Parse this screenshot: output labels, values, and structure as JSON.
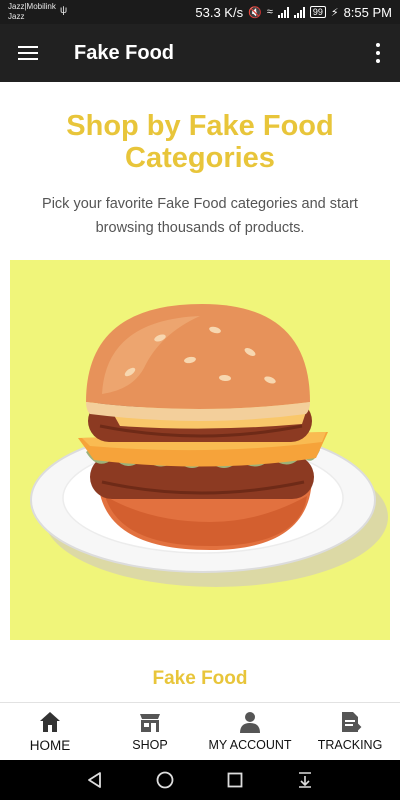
{
  "status_bar": {
    "carrier_line1": "Jazz|Mobilink",
    "carrier_line2": "Jazz",
    "speed": "53.3 K/s",
    "battery": "99",
    "time": "8:55 PM"
  },
  "app_bar": {
    "title": "Fake Food",
    "menu_icon": "hamburger-menu-icon",
    "more_icon": "more-vertical-icon"
  },
  "main": {
    "headline": "Shop by Fake Food Categories",
    "subtext": "Pick your favorite Fake Food categories and start browsing thousands of products.",
    "hero_image": "burger-illustration",
    "hero_bg_color": "#f0f57a",
    "section_title": "Fake Food",
    "accent_color": "#e8c53a"
  },
  "bottom_nav": {
    "items": [
      {
        "label": "HOME",
        "icon": "home-icon"
      },
      {
        "label": "SHOP",
        "icon": "shop-icon"
      },
      {
        "label": "MY ACCOUNT",
        "icon": "account-icon"
      },
      {
        "label": "TRACKING",
        "icon": "tracking-icon"
      }
    ]
  },
  "system_nav": {
    "icons": [
      "back-icon",
      "home-circle-icon",
      "recents-icon",
      "download-icon"
    ]
  }
}
